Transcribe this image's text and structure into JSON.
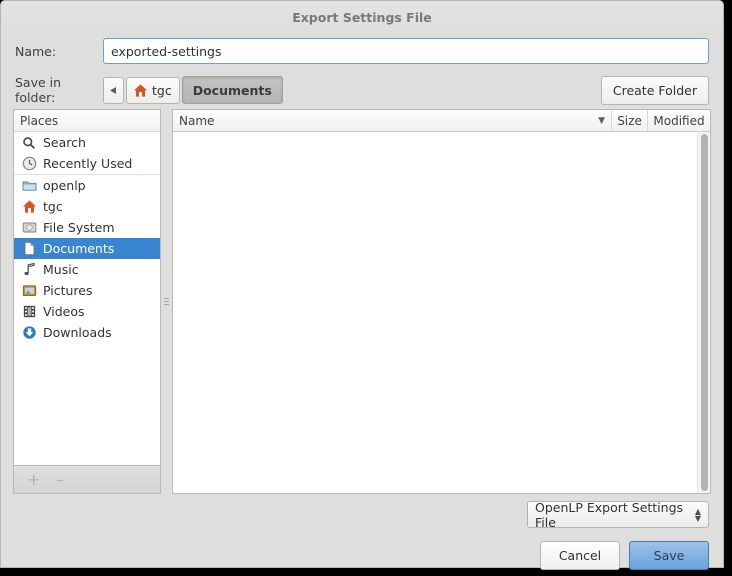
{
  "window": {
    "title": "Export Settings File"
  },
  "name_field": {
    "label": "Name:",
    "value": "exported-settings",
    "placeholder": ""
  },
  "folder_field": {
    "label": "Save in folder:",
    "back_icon": "left-arrow-icon",
    "crumbs": [
      {
        "label": "tgc",
        "icon": "home-icon",
        "active": false
      },
      {
        "label": "Documents",
        "icon": "",
        "active": true
      }
    ],
    "create_folder_label": "Create Folder"
  },
  "places": {
    "header": "Places",
    "items": [
      {
        "label": "Search",
        "icon": "search-icon",
        "selected": false
      },
      {
        "label": "Recently Used",
        "icon": "clock-icon",
        "selected": false
      },
      {
        "label": "openlp",
        "icon": "folder-icon",
        "selected": false
      },
      {
        "label": "tgc",
        "icon": "home-icon",
        "selected": false
      },
      {
        "label": "File System",
        "icon": "harddisk-icon",
        "selected": false
      },
      {
        "label": "Documents",
        "icon": "document-icon",
        "selected": true
      },
      {
        "label": "Music",
        "icon": "music-note-icon",
        "selected": false
      },
      {
        "label": "Pictures",
        "icon": "picture-icon",
        "selected": false
      },
      {
        "label": "Videos",
        "icon": "film-icon",
        "selected": false
      },
      {
        "label": "Downloads",
        "icon": "download-arrow-icon",
        "selected": false
      }
    ],
    "add_label": "+",
    "remove_label": "–"
  },
  "file_list": {
    "columns": [
      {
        "label": "Name",
        "sort_indicator": "▼"
      },
      {
        "label": "Size",
        "sort_indicator": ""
      },
      {
        "label": "Modified",
        "sort_indicator": ""
      }
    ],
    "rows": []
  },
  "filter": {
    "selected": "OpenLP Export Settings File",
    "up_arrow": "▲",
    "down_arrow": "▼"
  },
  "buttons": {
    "cancel": "Cancel",
    "save": "Save"
  },
  "colors": {
    "selection_blue": "#3a85d0",
    "save_button_blue": "#6ba3da",
    "dialog_background": "#dededc",
    "focus_border": "#6ea2cc"
  }
}
